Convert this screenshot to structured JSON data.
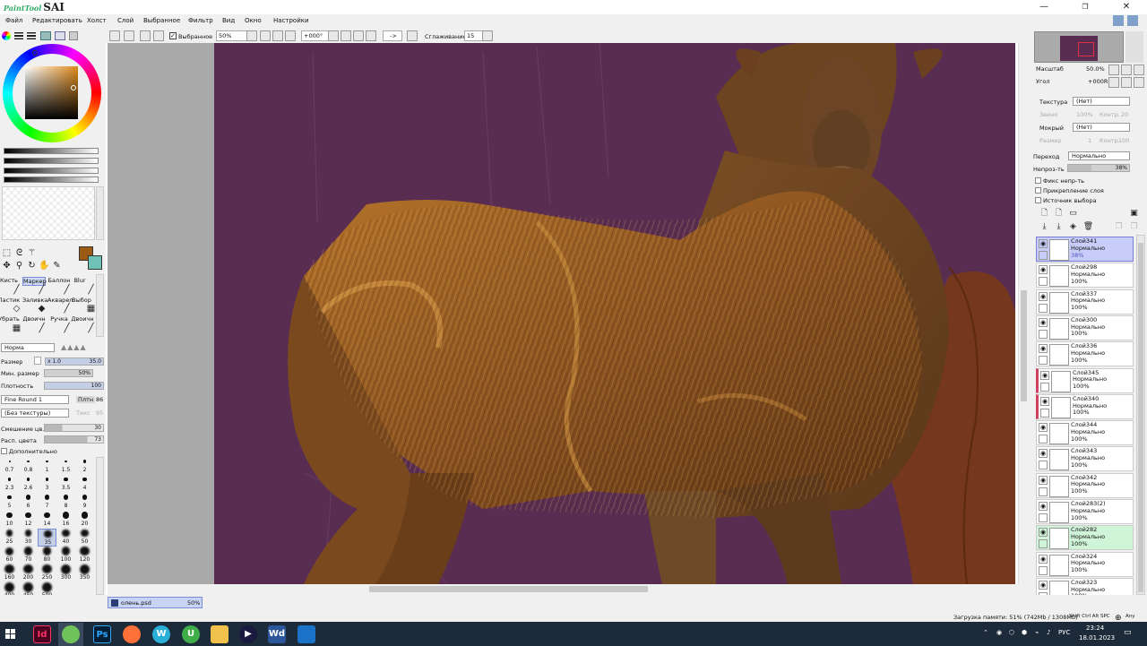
{
  "app": {
    "logo_small": "PaintTool",
    "logo_big": "SAI",
    "title_buttons": [
      "—",
      "❐",
      "✕"
    ]
  },
  "menu": [
    "Файл",
    "Редактировать",
    "Холст",
    "Слой",
    "Выбранное",
    "Фильтр",
    "Вид",
    "Окно",
    "Настройки"
  ],
  "toolbar": {
    "selected_label": "Выбранное",
    "zoom": "50%",
    "angle": "+000°",
    "arrow": "->",
    "smooth_label": "Сглаживание",
    "smooth_value": "15"
  },
  "colors": {
    "primary": "#9a5a14",
    "secondary": "#6fc3b6",
    "canvas_bg": "#592d52"
  },
  "tools": {
    "row_labels1": [
      "Кисть",
      "Маркер",
      "Баллон",
      "Blur"
    ],
    "row_labels2": [
      "Ластик",
      "Заливка",
      "Акварел",
      "Выбор"
    ],
    "row_labels3": [
      "Убрать",
      "Двоичн",
      "Ручка",
      "Двоичн"
    ]
  },
  "brush": {
    "mode": "Норма",
    "size_label": "Размер",
    "size_mult": "x 1.0",
    "size_value": "35.0",
    "min_size_label": "Мин. размер",
    "min_size_value": "50%",
    "density_label": "Плотность",
    "density_value": "100",
    "shape": "Fine Round 1",
    "shape_val_label": "Плтн",
    "shape_val": "86",
    "texture": "(Без текстуры)",
    "texture_val_label": "Текс",
    "texture_val": "95",
    "blend_label": "Смешение цв.",
    "blend_value": "30",
    "dilute_label": "Расп. цвета",
    "dilute_value": "73",
    "extra_label": "Дополнительно"
  },
  "brush_sizes": [
    "0.7",
    "0.8",
    "1",
    "1.5",
    "2",
    "2.3",
    "2.6",
    "3",
    "3.5",
    "4",
    "5",
    "6",
    "7",
    "8",
    "9",
    "10",
    "12",
    "14",
    "16",
    "20",
    "25",
    "30",
    "35",
    "40",
    "50",
    "60",
    "70",
    "80",
    "100",
    "120",
    "160",
    "200",
    "250",
    "300",
    "350",
    "400",
    "450",
    "500"
  ],
  "navigator": {
    "zoom_label": "Масштаб",
    "zoom_value": "50.0%",
    "angle_label": "Угол",
    "angle_value": "+000R"
  },
  "layer_props": {
    "texture_label": "Текстура",
    "texture_value": "(Нет)",
    "scale_label": "Звено",
    "scale_value": "100%",
    "contrast_label": "Контр.",
    "contrast_value": "20",
    "wet_label": "Мокрый",
    "wet_value": "(Нет)",
    "size_label": "Размер",
    "size_value": "1",
    "contrast2_label": "Контр.",
    "contrast2_value": "100",
    "blend_label": "Переход",
    "blend_value": "Нормально",
    "opacity_label": "Непроз-ть",
    "opacity_value": "38%",
    "opacity_fraction": 0.38,
    "fix_opacity": "Фикс непр-ть",
    "clip": "Прикрепление слоя",
    "selection_source": "Источник выбора"
  },
  "layers": [
    {
      "name": "Слой341",
      "mode": "Нормально",
      "opacity": "38%",
      "selected": true
    },
    {
      "name": "Слой298",
      "mode": "Нормально",
      "opacity": "100%"
    },
    {
      "name": "Слой337",
      "mode": "Нормально",
      "opacity": "100%"
    },
    {
      "name": "Слой300",
      "mode": "Нормально",
      "opacity": "100%"
    },
    {
      "name": "Слой336",
      "mode": "Нормально",
      "opacity": "100%"
    },
    {
      "name": "Слой345",
      "mode": "Нормально",
      "opacity": "100%"
    },
    {
      "name": "Слой340",
      "mode": "Нормально",
      "opacity": "100%"
    },
    {
      "name": "Слой344",
      "mode": "Нормально",
      "opacity": "100%"
    },
    {
      "name": "Слой343",
      "mode": "Нормально",
      "opacity": "100%"
    },
    {
      "name": "Слой342",
      "mode": "Нормально",
      "opacity": "100%"
    },
    {
      "name": "Слой283(2)",
      "mode": "Нормально",
      "opacity": "100%"
    },
    {
      "name": "Слой282",
      "mode": "Нормально",
      "opacity": "100%"
    },
    {
      "name": "Слой324",
      "mode": "Нормально",
      "opacity": "100%"
    },
    {
      "name": "Слой323",
      "mode": "Нормально",
      "opacity": "100%"
    }
  ],
  "document": {
    "tab_name": "олень.psd",
    "tab_zoom": "50%"
  },
  "status": {
    "memory": "Загрузка памяти: 51% (742Mb / 1308Mb)",
    "keys": "Shift Ctrl Alt SPC",
    "any": "Any"
  },
  "taskbar": {
    "lang": "РУС",
    "time": "23:24",
    "date": "18.01.2023",
    "apps": [
      "Id",
      "Ps",
      "Fx",
      "W",
      "U",
      "Fd",
      "Pl",
      "Wd",
      "Ph"
    ]
  }
}
